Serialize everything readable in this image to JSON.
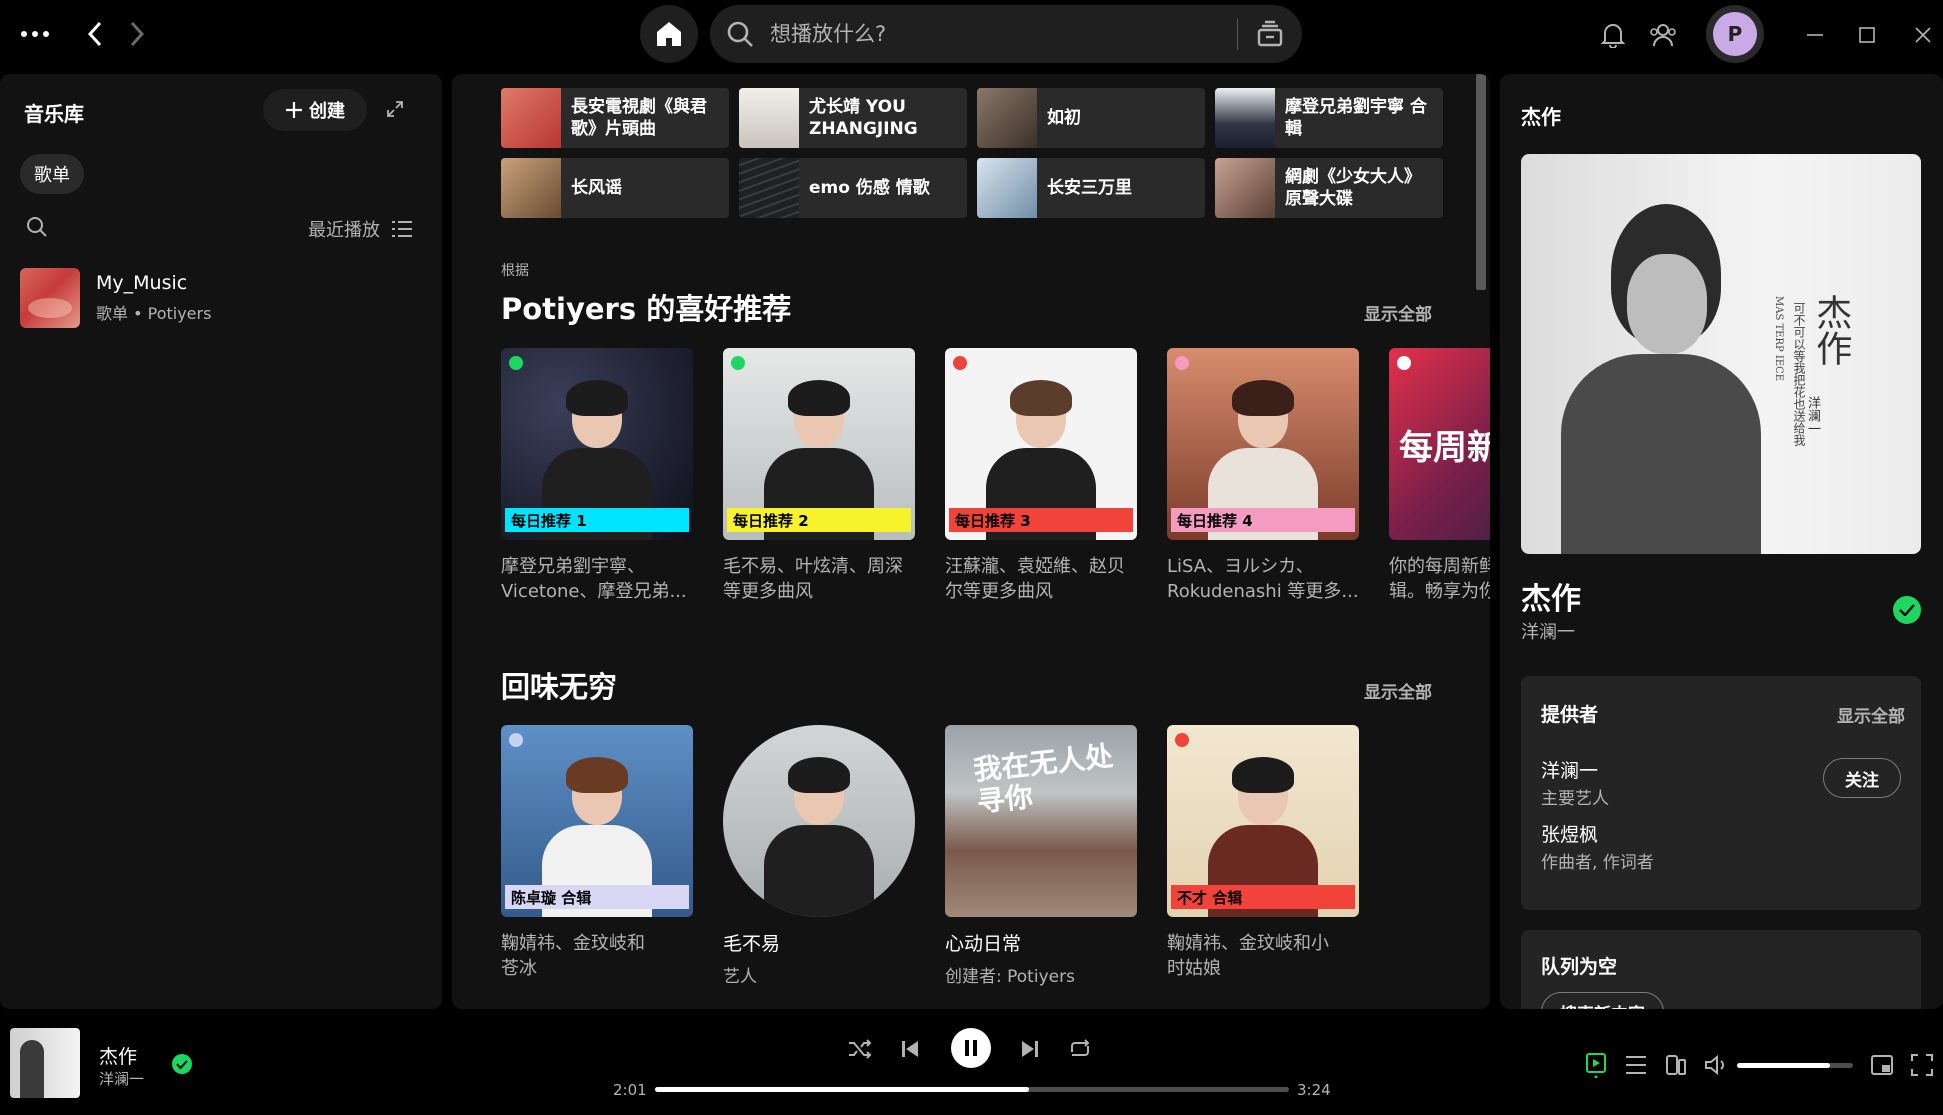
{
  "topbar": {
    "search_placeholder": "想播放什么?",
    "avatar_letter": "P"
  },
  "library": {
    "title": "音乐库",
    "create_label": "创建",
    "filter_chip": "歌单",
    "sort_label": "最近播放",
    "items": [
      {
        "name": "My_Music",
        "subtitle": "歌单 • Potiyers"
      }
    ]
  },
  "quick_picks": [
    {
      "title": "長安電視劇《與君歌》片頭曲",
      "cover_color": "#c9524a"
    },
    {
      "title": "尤长靖 YOU ZHANGJING",
      "cover_color": "#e7e3de"
    },
    {
      "title": "如初",
      "cover_color": "#5f5148"
    },
    {
      "title": "摩登兄弟劉宇寧 合輯",
      "cover_color": "#2f3644"
    },
    {
      "title": "长风谣",
      "cover_color": "#a57b57"
    },
    {
      "title": "emo 伤感 情歌",
      "cover_color": "#242628"
    },
    {
      "title": "长安三万里",
      "cover_color": "#98b0c4"
    },
    {
      "title": "網劇《少女大人》原聲大碟",
      "cover_color": "#8a6b5e"
    }
  ],
  "section1": {
    "pretitle": "根据",
    "title": "Potiyers 的喜好推荐",
    "show_all": "显示全部",
    "cards": [
      {
        "tag": "每日推荐 1",
        "tag_color": "#00e5ff",
        "bg": "#1c2030",
        "desc1": "摩登兄弟劉宇寧、",
        "desc2": "Vicetone、摩登兄弟..."
      },
      {
        "tag": "每日推荐 2",
        "tag_color": "#f6f22b",
        "bg": "#d5d8d8",
        "desc1": "毛不易、叶炫清、周深",
        "desc2": "等更多曲风"
      },
      {
        "tag": "每日推荐 3",
        "tag_color": "#f2433b",
        "bg": "#f2f2f2",
        "desc1": "汪蘇瀧、袁婭維、赵贝",
        "desc2": "尔等更多曲风"
      },
      {
        "tag": "每日推荐 4",
        "tag_color": "#f59ac0",
        "bg": "#c87b62",
        "desc1": "LiSA、ヨルシカ、",
        "desc2": "Rokudenashi 等更多..."
      },
      {
        "tag": "每周新鲜",
        "tag_color": "#e12e4b",
        "bg": "#b8253c",
        "desc1": "你的每周新鲜",
        "desc2": "辑。畅享为你"
      }
    ]
  },
  "section2": {
    "title": "回味无穷",
    "show_all": "显示全部",
    "cards": [
      {
        "tag": "陈卓璇 合辑",
        "tag_color": "#d8d8f5",
        "bg": "#4f7fb5",
        "line1": "鞠婧祎、金玟岐和",
        "line2": "苍冰",
        "kind": "mix"
      },
      {
        "title": "毛不易",
        "sub": "艺人",
        "bg": "#c9cccc",
        "kind": "artist"
      },
      {
        "title": "心动日常",
        "sub": "创建者: Potiyers",
        "bg": "#8a8a8a",
        "cover_text": "我在无人处寻你",
        "kind": "playlist"
      },
      {
        "tag": "不才 合辑",
        "tag_color": "#f2433b",
        "bg": "#efe3c9",
        "line1": "鞠婧祎、金玟岐和小",
        "line2": "时姑娘",
        "kind": "mix"
      }
    ]
  },
  "right_panel": {
    "header": "杰作",
    "art_title": "杰作",
    "art_small1": "MAS TERP IECE",
    "art_small2": "可不可以等我把花也送给我",
    "art_artist": "洋澜一",
    "track": "杰作",
    "artist": "洋澜一",
    "credits_title": "提供者",
    "credits_show_all": "显示全部",
    "credits": [
      {
        "name": "洋澜一",
        "role": "主要艺人"
      },
      {
        "name": "张煜枫",
        "role": "作曲者, 作词者"
      }
    ],
    "follow_label": "关注",
    "queue_title": "队列为空",
    "queue_button": "搜索新内容"
  },
  "player": {
    "title": "杰作",
    "artist": "洋澜一",
    "elapsed": "2:01",
    "duration": "3:24",
    "progress": 0.59,
    "volume": 0.8
  },
  "colors": {
    "accent": "#1ed760",
    "surface": "#121212",
    "elevated": "#2a2a2a"
  }
}
